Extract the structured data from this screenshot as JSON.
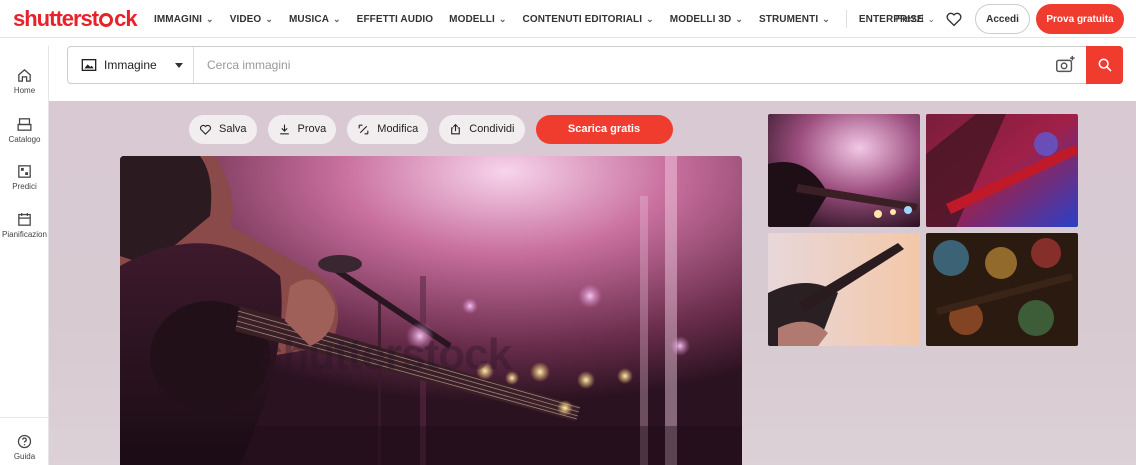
{
  "logo": {
    "text_a": "shutterst",
    "text_b": "ck"
  },
  "nav": {
    "items": [
      {
        "label": "IMMAGINI",
        "has_dropdown": true
      },
      {
        "label": "VIDEO",
        "has_dropdown": true
      },
      {
        "label": "MUSICA",
        "has_dropdown": true
      },
      {
        "label": "EFFETTI AUDIO",
        "has_dropdown": false
      },
      {
        "label": "MODELLI",
        "has_dropdown": true
      },
      {
        "label": "CONTENUTI EDITORIALI",
        "has_dropdown": true
      },
      {
        "label": "MODELLI 3D",
        "has_dropdown": true
      },
      {
        "label": "STRUMENTI",
        "has_dropdown": true
      },
      {
        "label": "ENTERPRISE",
        "has_dropdown": false
      }
    ],
    "prezzi": "Prezzi",
    "accedi": "Accedi",
    "prova_gratuita": "Prova gratuita"
  },
  "sidebar": {
    "home": "Home",
    "catalogo": "Catalogo",
    "predici": "Predici",
    "pianificazione": "Pianificazion",
    "guida": "Guida"
  },
  "search": {
    "type": "Immagine",
    "placeholder": "Cerca immagini"
  },
  "actions": {
    "salva": "Salva",
    "prova": "Prova",
    "modifica": "Modifica",
    "condividi": "Condividi",
    "scarica": "Scarica gratis"
  },
  "watermark": "shutterstock",
  "colors": {
    "brand": "#e8222a",
    "cta": "#f03c2e",
    "hero_bg": "#d8c9d2"
  }
}
